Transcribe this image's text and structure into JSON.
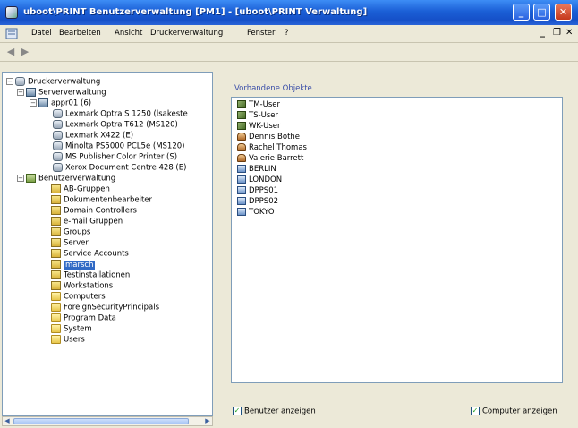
{
  "titlebar": {
    "title": "uboot\\PRINT Benutzerverwaltung [PM1] - [uboot\\PRINT Verwaltung]",
    "minimize": "_",
    "maximize": "□",
    "restore": "❐",
    "close": "✕"
  },
  "menubar": {
    "items": [
      "Datei",
      "Bearbeiten",
      "Ansicht",
      "Druckerverwaltung",
      "Fenster",
      "?"
    ],
    "mdi_minimize": "_",
    "mdi_restore": "❐",
    "mdi_close": "✕"
  },
  "toolbar": {
    "back": "◀",
    "forward": "▶"
  },
  "tree": {
    "root": "Druckerverwaltung",
    "server_management": "Serververwaltung",
    "server": "appr01 (6)",
    "printers": [
      "Lexmark Optra S 1250 (lsakeste",
      "Lexmark Optra T612 (MS120)",
      "Lexmark X422 (E)",
      "Minolta PS5000 PCL5e (MS120)",
      "MS Publisher Color Printer (S)",
      "Xerox Document Centre 428 (E)"
    ],
    "user_management": "Benutzerverwaltung",
    "ous": [
      "AB-Gruppen",
      "Dokumentenbearbeiter",
      "Domain Controllers",
      "e-mail Gruppen",
      "Groups",
      "Server",
      "Service Accounts",
      "marsch",
      "Testinstallationen",
      "Workstations"
    ],
    "containers": [
      "Computers",
      "ForeignSecurityPrincipals",
      "Program Data",
      "System",
      "Users"
    ],
    "selected_ou": "marsch"
  },
  "right": {
    "caption": "Vorhandene Objekte",
    "objects": [
      {
        "label": "TM-User",
        "type": "group"
      },
      {
        "label": "TS-User",
        "type": "group"
      },
      {
        "label": "WK-User",
        "type": "group"
      },
      {
        "label": "Dennis Bothe",
        "type": "user"
      },
      {
        "label": "Rachel Thomas",
        "type": "user"
      },
      {
        "label": "Valerie Barrett",
        "type": "user"
      },
      {
        "label": "BERLIN",
        "type": "computer"
      },
      {
        "label": "LONDON",
        "type": "computer"
      },
      {
        "label": "DPPS01",
        "type": "computer"
      },
      {
        "label": "DPPS02",
        "type": "computer"
      },
      {
        "label": "TOKYO",
        "type": "computer"
      }
    ],
    "show_users_label": "Benutzer anzeigen",
    "show_users_checked": true,
    "show_computers_label": "Computer anzeigen",
    "show_computers_checked": true,
    "check_mark": "✓"
  },
  "colors": {
    "titlebar": "#1b5fd6",
    "selection": "#316ac5",
    "caption": "#3a4ea8"
  }
}
